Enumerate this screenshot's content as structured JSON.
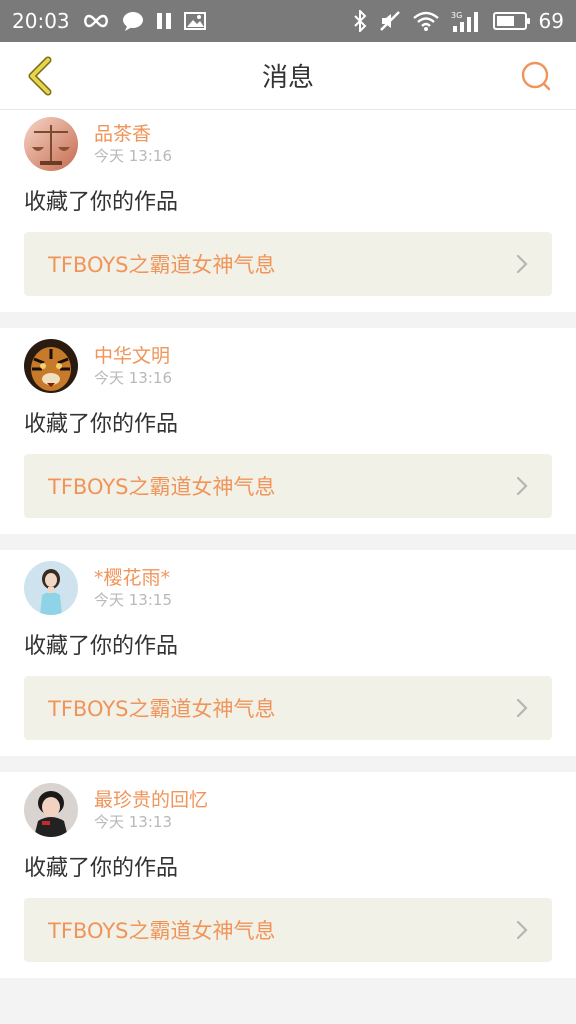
{
  "status_bar": {
    "time": "20:03",
    "battery_level": "69",
    "battery_fill_fraction": 0.69,
    "icons": [
      "infinity-icon",
      "chat-icon",
      "pause-icon",
      "image-icon",
      "bluetooth-icon",
      "mute-icon",
      "wifi-icon",
      "signal-3g-icon",
      "battery-icon"
    ]
  },
  "header": {
    "title": "消息",
    "back_icon": "chevron-left-icon",
    "search_icon": "search-icon"
  },
  "colors": {
    "accent": "#f0955a",
    "back_arrow": "#e7d64a",
    "link_bg": "#f2f1e8"
  },
  "notifications": [
    {
      "username": "品茶香",
      "time": "今天 13:16",
      "action": "收藏了你的作品",
      "work_title": "TFBOYS之霸道女神气息",
      "avatar": "scales-avatar"
    },
    {
      "username": "中华文明",
      "time": "今天 13:16",
      "action": "收藏了你的作品",
      "work_title": "TFBOYS之霸道女神气息",
      "avatar": "tiger-avatar"
    },
    {
      "username": "*樱花雨*",
      "time": "今天 13:15",
      "action": "收藏了你的作品",
      "work_title": "TFBOYS之霸道女神气息",
      "avatar": "girl-avatar"
    },
    {
      "username": "最珍贵的回忆",
      "time": "今天 13:13",
      "action": "收藏了你的作品",
      "work_title": "TFBOYS之霸道女神气息",
      "avatar": "boy-avatar"
    }
  ]
}
